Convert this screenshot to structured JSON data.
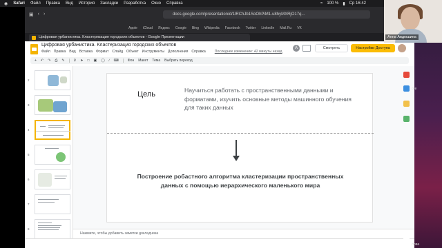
{
  "menubar": {
    "app": "Safari",
    "items": [
      "Файл",
      "Правка",
      "Вид",
      "История",
      "Закладки",
      "Разработка",
      "Окно",
      "Справка"
    ],
    "battery": "100 %",
    "clock": "Ср 16:42"
  },
  "browser": {
    "url": "docs.google.com/presentation/d/1lRChJb1SoOhPiM1-u8hyMXRjO17q...",
    "bookmarks": [
      "Apple",
      "iCloud",
      "Яндекс",
      "Google",
      "Bing",
      "Wikipedia",
      "Facebook",
      "Twitter",
      "LinkedIn",
      "Mail.Ru",
      "VK"
    ],
    "tab_title": "Цифровая урбанистика. Кластеризация городских объектов - Google Презентации"
  },
  "docs": {
    "title": "Цифровая урбанистика. Кластеризация городских объектов",
    "menus": [
      "Файл",
      "Правка",
      "Вид",
      "Вставка",
      "Формат",
      "Слайд",
      "Объект",
      "Инструменты",
      "Дополнения",
      "Справка"
    ],
    "last_edit": "Последнее изменение: 42 минуты назад",
    "avatar_letter": "A",
    "view_button": "Смотреть",
    "share_button": "Настройки Доступа",
    "toolbar": {
      "background": "Фон",
      "layout": "Макет",
      "theme": "Тема",
      "transition": "Выбрать переход"
    }
  },
  "filmstrip": {
    "slide_numbers": [
      "2",
      "3",
      "4",
      "5",
      "6",
      "7",
      "8"
    ],
    "selected_slide": "4"
  },
  "slide": {
    "goal_label": "Цель",
    "goal_text": "Научиться работать с пространственными данными и форматами, изучить основные методы машинного обучения для таких данных",
    "result_text": "Построение робастного алгоритма кластеризации пространственных данных с помощью иерархического маленького мира"
  },
  "notes": {
    "placeholder": "Нажмите, чтобы добавить заметки докладчика"
  },
  "webcam": {
    "name": "Анна Авдюшина"
  },
  "dock_labels": [
    "ore",
    "лова"
  ],
  "colors": {
    "accent": "#fbbc04",
    "selected_thumb": "#f4b400"
  }
}
